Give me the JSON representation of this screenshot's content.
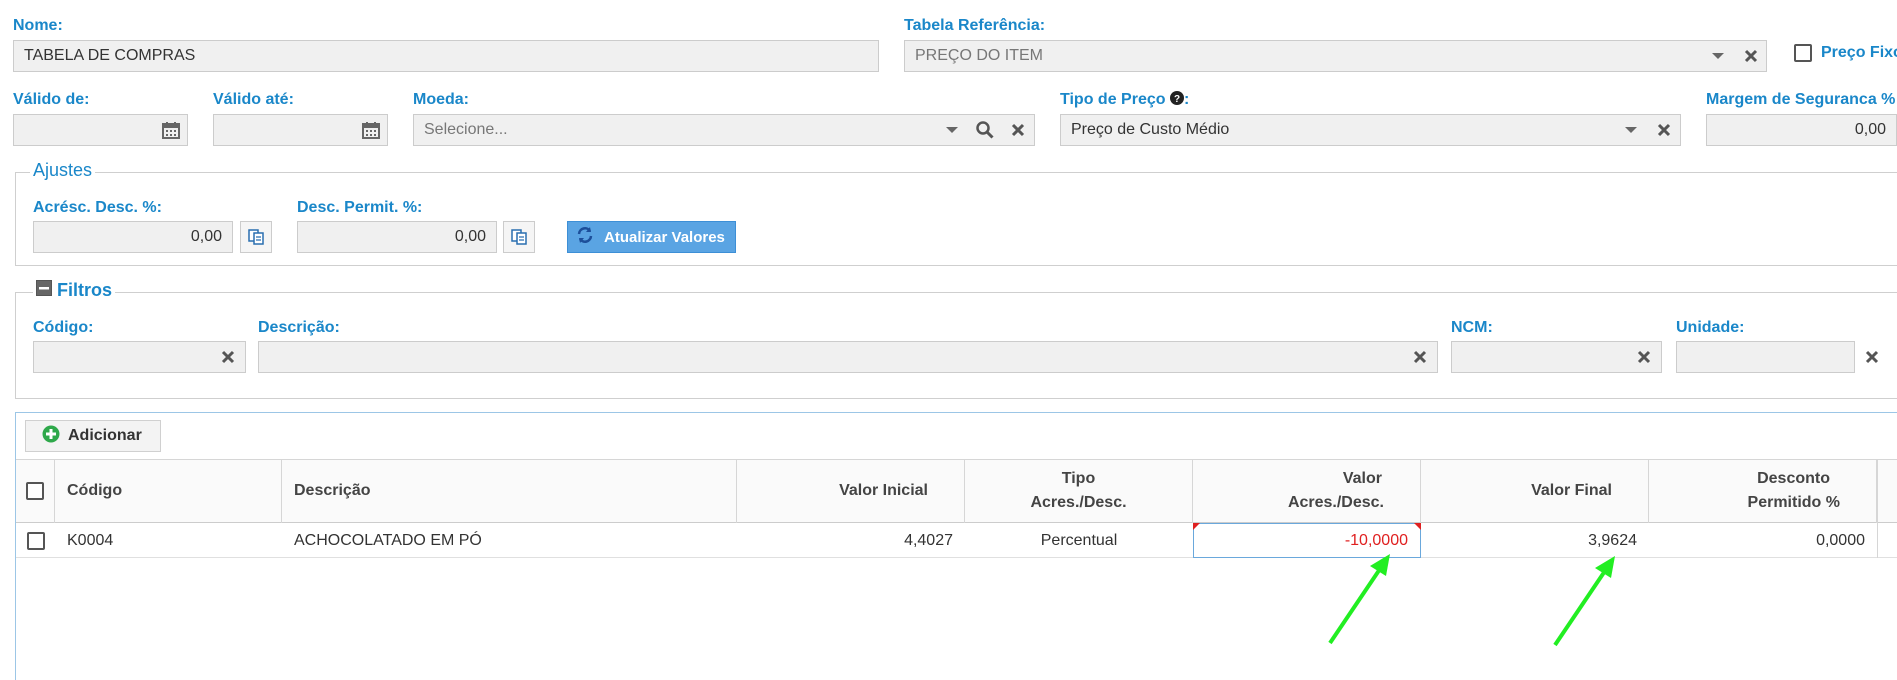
{
  "form": {
    "nome": {
      "label": "Nome:",
      "value": "TABELA DE COMPRAS"
    },
    "tabela_referencia": {
      "label": "Tabela Referência:",
      "value": "PREÇO DO ITEM"
    },
    "preco_fixo": {
      "label": "Preço Fixo"
    },
    "valido_de": {
      "label": "Válido de:",
      "value": ""
    },
    "valido_ate": {
      "label": "Válido até:",
      "value": ""
    },
    "moeda": {
      "label": "Moeda:",
      "placeholder": "Selecione..."
    },
    "tipo_preco": {
      "label": "Tipo de Preço",
      "value": "Preço de Custo Médio"
    },
    "margem_seguranca": {
      "label": "Margem de Seguranca %",
      "value": "0,00"
    }
  },
  "ajustes": {
    "legend": "Ajustes",
    "acresc_desc": {
      "label": "Acrésc. Desc. %:",
      "value": "0,00"
    },
    "desc_permit": {
      "label": "Desc. Permit. %:",
      "value": "0,00"
    },
    "atualizar_label": "Atualizar Valores"
  },
  "filtros": {
    "legend": "Filtros",
    "codigo": {
      "label": "Código:",
      "value": ""
    },
    "descricao": {
      "label": "Descrição:",
      "value": ""
    },
    "ncm": {
      "label": "NCM:",
      "value": ""
    },
    "unidade": {
      "label": "Unidade:",
      "value": ""
    }
  },
  "grid": {
    "add_label": "Adicionar",
    "columns": {
      "codigo": "Código",
      "descricao": "Descrição",
      "valor_inicial": "Valor Inicial",
      "tipo_line1": "Tipo",
      "tipo_line2": "Acres./Desc.",
      "valor_line1": "Valor",
      "valor_line2": "Acres./Desc.",
      "valor_final": "Valor Final",
      "desconto_line1": "Desconto",
      "desconto_line2": "Permitido %"
    },
    "rows": [
      {
        "codigo": "K0004",
        "descricao": "ACHOCOLATADO EM PÓ",
        "valor_inicial": "4,4027",
        "tipo": "Percentual",
        "valor_acres_desc": "-10,0000",
        "valor_final": "3,9624",
        "desconto_permitido": "0,0000"
      }
    ]
  },
  "colors": {
    "label_blue": "#1a87c9",
    "negative_red": "#e02020",
    "annotation_arrow": "#22ee22",
    "primary_button": "#5aa4e3"
  },
  "icons": [
    "calendar-icon",
    "caret-down-icon",
    "clear-x-icon",
    "search-icon",
    "help-circle-icon",
    "copy-icon",
    "refresh-icon",
    "collapse-minus-icon",
    "add-plus-icon",
    "checkbox-icon",
    "arrow-annotation"
  ]
}
